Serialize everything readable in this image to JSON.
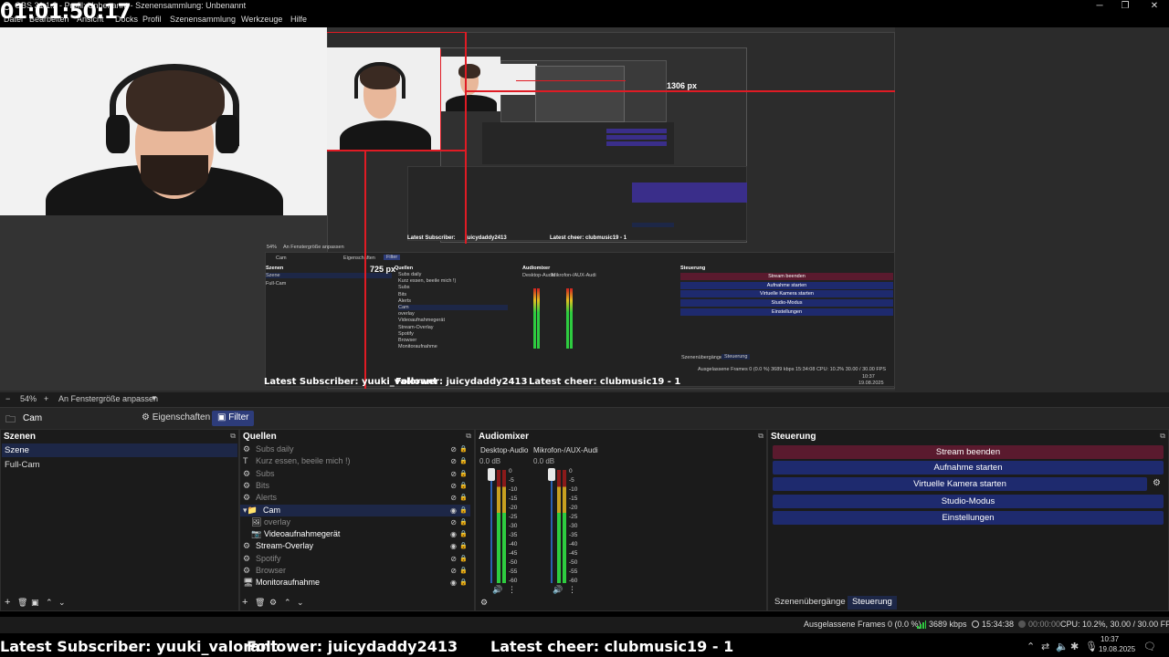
{
  "window": {
    "title": "OBS 31.1.2 - Profil: Unbenannt - Szenensammlung: Unbenannt",
    "minimize": "─",
    "maximize": "❐",
    "close": "✕"
  },
  "timer": "01:01:50:17",
  "menu": [
    "Datei",
    "Bearbeiten",
    "Ansicht",
    "Docks",
    "Profil",
    "Szenensammlung",
    "Werkzeuge",
    "Hilfe"
  ],
  "preview": {
    "measure_width": "1306 px",
    "measure_height": "725 px",
    "nested_subscriber": "Latest Subscriber: yuuki_valorant",
    "nested_follower": "Follower: juicydaddy2413",
    "nested_cheer": "Latest cheer: clubmusic19 - 1",
    "nested_zoom": "54%",
    "nested_fit": "An Fenstergröße anpassen",
    "nested_scene_name": "Cam",
    "nested_props": "Eigenschaften",
    "nested_filter": "Filter",
    "nested_scenes_title": "Szenen",
    "nested_scenes": [
      "Szene",
      "Full-Cam"
    ],
    "nested_sources_title": "Quellen",
    "nested_sources": [
      "Subs daily",
      "Kurz essen, beeile mich !)",
      "Subs",
      "Bits",
      "Alerts",
      "Cam",
      "overlay",
      "Videoaufnahmegerät",
      "Stream-Overlay",
      "Spotify",
      "Browser",
      "Monitoraufnahme"
    ],
    "nested_mixer_title": "Audiomixer",
    "nested_mixer_ch1": "Desktop-Audio",
    "nested_mixer_ch2": "Mikrofon-/AUX-Audi",
    "nested_controls_title": "Steuerung",
    "nested_controls": [
      "Stream beenden",
      "Aufnahme starten",
      "Virtuelle Kamera starten",
      "Studio-Modus",
      "Einstellungen"
    ],
    "nested_tab1": "Szenenübergänge",
    "nested_tab2": "Steuerung",
    "nested_status": "Ausgelassene Frames 0 (0.0 %)   3689 kbps   15:34:08   CPU: 10.2%  30.00 / 30.00 FPS",
    "nested_clock": "10:37",
    "nested_date": "19.08.2025"
  },
  "zoom": {
    "minus": "−",
    "value": "54%",
    "plus": "+",
    "fit_label": "An Fenstergröße anpassen",
    "dropdown": "▼"
  },
  "context": {
    "scene_name": "Cam",
    "properties_label": "Eigenschaften",
    "filter_label": "Filter"
  },
  "scenes": {
    "title": "Szenen",
    "items": [
      "Szene",
      "Full-Cam"
    ],
    "active_index": 0
  },
  "sources": {
    "title": "Quellen",
    "items": [
      {
        "name": "Subs daily",
        "icon": "⚙",
        "visible": false
      },
      {
        "name": "Kurz essen, beeile mich !)",
        "icon": "T",
        "visible": false
      },
      {
        "name": "Subs",
        "icon": "⚙",
        "visible": false
      },
      {
        "name": "Bits",
        "icon": "⚙",
        "visible": false
      },
      {
        "name": "Alerts",
        "icon": "⚙",
        "visible": false
      },
      {
        "name": "Cam",
        "icon": "▾📁",
        "visible": true
      },
      {
        "name": "overlay",
        "icon": "🖼",
        "visible": false
      },
      {
        "name": "Videoaufnahmegerät",
        "icon": "📷",
        "visible": true
      },
      {
        "name": "Stream-Overlay",
        "icon": "⚙",
        "visible": true
      },
      {
        "name": "Spotify",
        "icon": "⚙",
        "visible": false
      },
      {
        "name": "Browser",
        "icon": "⚙",
        "visible": false
      },
      {
        "name": "Monitoraufnahme",
        "icon": "🖥",
        "visible": true
      }
    ],
    "active_index": 5
  },
  "mixer": {
    "title": "Audiomixer",
    "channels": [
      {
        "name": "Desktop-Audio",
        "db": "0.0 dB"
      },
      {
        "name": "Mikrofon-/AUX-Audi",
        "db": "0.0 dB"
      }
    ],
    "scale": [
      "0",
      "-5",
      "-10",
      "-15",
      "-20",
      "-25",
      "-30",
      "-35",
      "-40",
      "-45",
      "-50",
      "-55",
      "-60"
    ]
  },
  "controls": {
    "title": "Steuerung",
    "buttons": [
      "Stream beenden",
      "Aufnahme starten",
      "Virtuelle Kamera starten",
      "Studio-Modus",
      "Einstellungen"
    ],
    "tabs": [
      "Szenenübergänge",
      "Steuerung"
    ],
    "active_tab": 1,
    "colors": {
      "stream_end": "#5a1a2e",
      "button": "#1e2a6e",
      "tab_active": "#1d2747"
    }
  },
  "status": {
    "dropped": "Ausgelassene Frames 0 (0.0 %)",
    "bitrate": "3689 kbps",
    "stream_time": "15:34:38",
    "rec_time": "00:00:00",
    "cpu_fps": "CPU: 10.2%, 30.00 / 30.00 FPS"
  },
  "overlay": {
    "subscriber": "Latest Subscriber: yuuki_valorant",
    "follower": "Follower: juicydaddy2413",
    "cheer": "Latest cheer: clubmusic19 - 1"
  },
  "tray": {
    "time": "10:37",
    "date": "19.08.2025"
  }
}
